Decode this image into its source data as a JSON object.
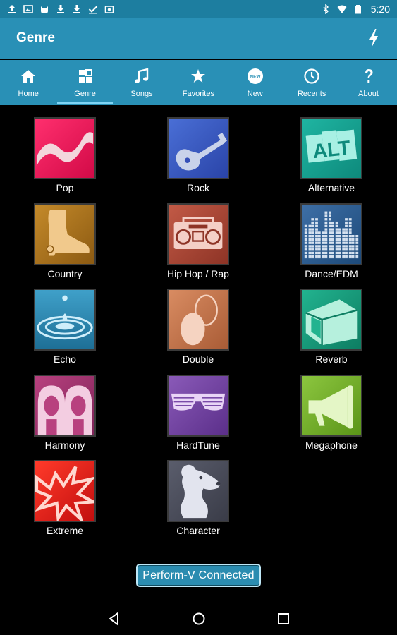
{
  "status_bar": {
    "time": "5:20",
    "left_icons": [
      "upload-icon",
      "image-icon",
      "cat-icon",
      "download-icon",
      "download-icon",
      "check-icon",
      "photos-icon"
    ],
    "right_icons": [
      "bluetooth-icon",
      "wifi-icon",
      "battery-icon"
    ]
  },
  "app_bar": {
    "title": "Genre",
    "action_icon": "lightning-bolt-icon"
  },
  "tabs": [
    {
      "label": "Home",
      "icon": "home-icon"
    },
    {
      "label": "Genre",
      "icon": "grid-icon",
      "active": true
    },
    {
      "label": "Songs",
      "icon": "music-note-icon"
    },
    {
      "label": "Favorites",
      "icon": "star-icon"
    },
    {
      "label": "New",
      "icon": "new-badge-icon",
      "badge": "NEW"
    },
    {
      "label": "Recents",
      "icon": "clock-icon"
    },
    {
      "label": "About",
      "icon": "question-icon"
    }
  ],
  "genres": [
    {
      "label": "Pop",
      "icon": "pop-wave-icon"
    },
    {
      "label": "Rock",
      "icon": "guitar-icon"
    },
    {
      "label": "Alternative",
      "icon": "alt-icon",
      "icon_text": "ALT"
    },
    {
      "label": "Country",
      "icon": "cowboy-boot-icon"
    },
    {
      "label": "Hip Hop / Rap",
      "icon": "boombox-icon"
    },
    {
      "label": "Dance/EDM",
      "icon": "equalizer-icon"
    },
    {
      "label": "Echo",
      "icon": "water-drop-icon"
    },
    {
      "label": "Double",
      "icon": "double-circles-icon"
    },
    {
      "label": "Reverb",
      "icon": "room-icon"
    },
    {
      "label": "Harmony",
      "icon": "two-faces-icon"
    },
    {
      "label": "HardTune",
      "icon": "shutter-shades-icon"
    },
    {
      "label": "Megaphone",
      "icon": "megaphone-icon"
    },
    {
      "label": "Extreme",
      "icon": "lightning-burst-icon"
    },
    {
      "label": "Character",
      "icon": "mouse-character-icon"
    }
  ],
  "connect_button": {
    "label": "Perform-V  Connected"
  },
  "nav_bar": {
    "icons": [
      "back-icon",
      "home-circle-icon",
      "recents-square-icon"
    ]
  },
  "colors": {
    "status_bar": "#1d7ea0",
    "app_bar": "#2990b6",
    "tab_indicator": "#7fd4f5",
    "background": "#000000"
  }
}
